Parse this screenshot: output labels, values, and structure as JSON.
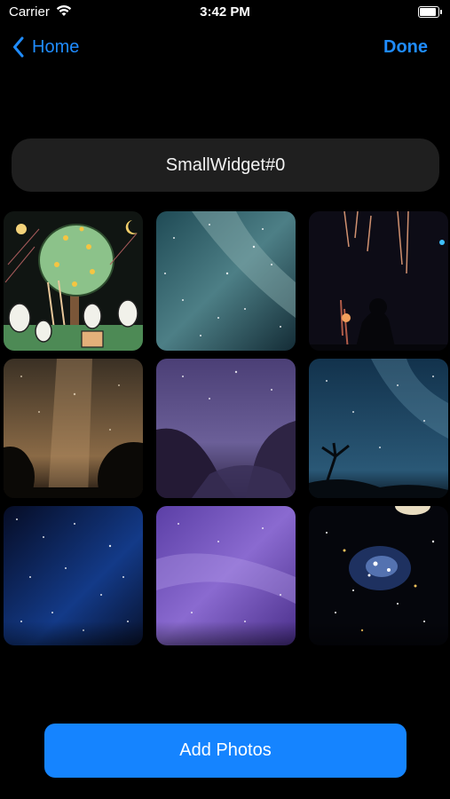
{
  "status_bar": {
    "carrier": "Carrier",
    "time": "3:42 PM"
  },
  "nav": {
    "back_label": "Home",
    "done_label": "Done"
  },
  "widget": {
    "name": "SmallWidget#0"
  },
  "photos": [
    {
      "subject": "cartoon-party-tree"
    },
    {
      "subject": "milky-way-teal"
    },
    {
      "subject": "fireworks-silhouette"
    },
    {
      "subject": "milky-way-forest"
    },
    {
      "subject": "purple-valley-night"
    },
    {
      "subject": "starry-sky-tree"
    },
    {
      "subject": "blue-starfield"
    },
    {
      "subject": "purple-nebula-sky"
    },
    {
      "subject": "deep-space-cluster"
    }
  ],
  "add_photos_label": "Add Photos",
  "colors": {
    "accent": "#1f8cff",
    "button": "#1584ff",
    "field": "#1f1f1f"
  }
}
